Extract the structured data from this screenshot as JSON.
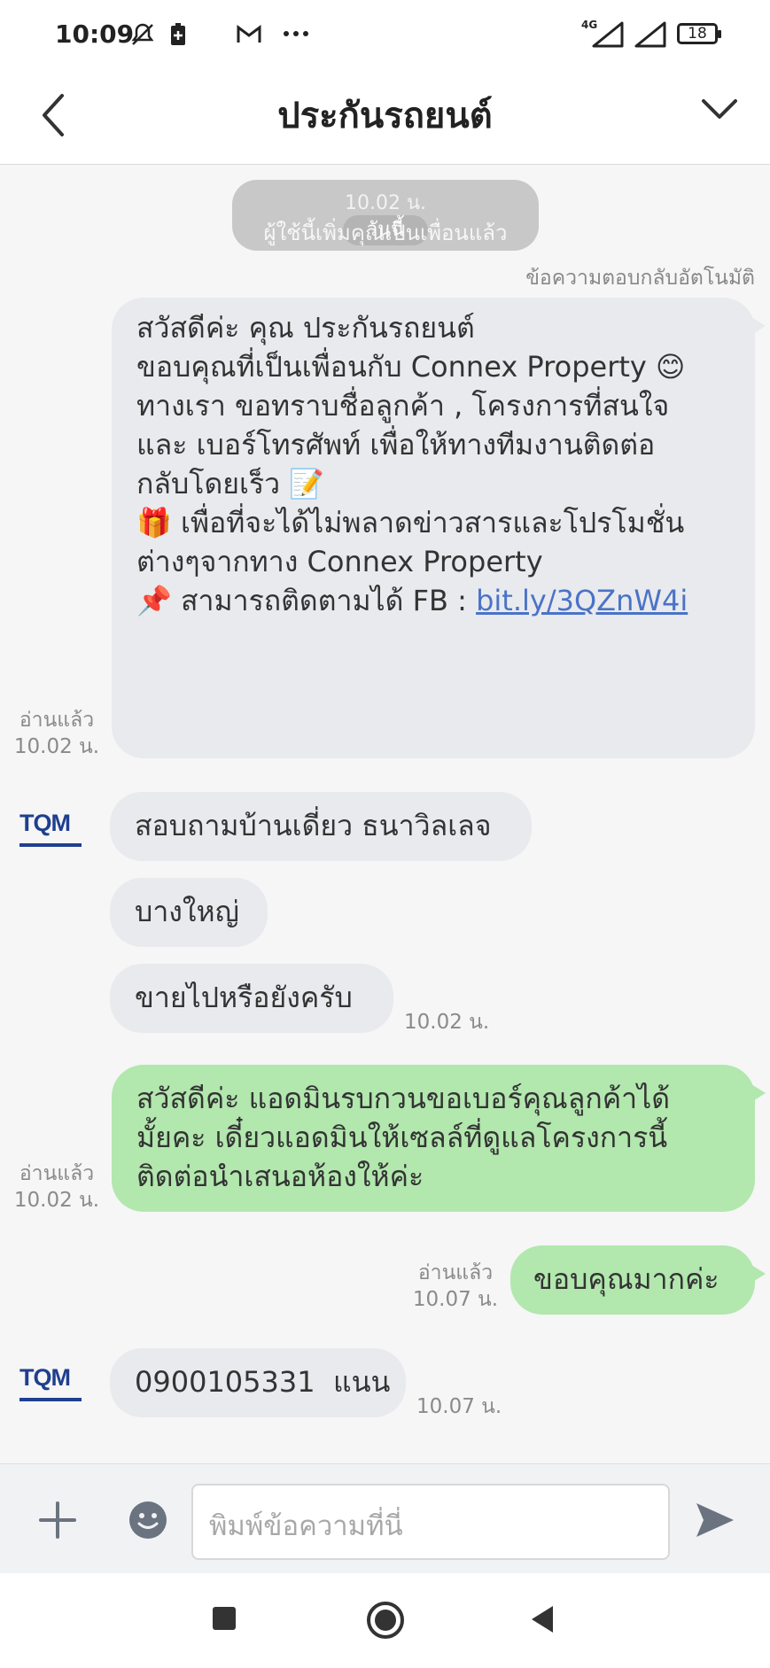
{
  "status_bar": {
    "time": "10:09",
    "network": "4G",
    "battery": "18"
  },
  "header": {
    "title": "ประกันรถยนต์"
  },
  "system_notice": {
    "time": "10.02 น.",
    "day": "วันนี้",
    "text": "ผู้ใช้นี้เพิ่มคุณเป็นเพื่อนแล้ว"
  },
  "auto_reply_label": "ข้อความตอบกลับอัตโนมัติ",
  "messages": [
    {
      "lines": [
        "สวัสดีค่ะ คุณ ประกันรถยนต์",
        "",
        "ขอบคุณที่เป็นเพื่อนกับ Connex Property 😊",
        "",
        "ทางเรา ขอทราบชื่อลูกค้า , โครงการที่สนใจ",
        "และ เบอร์โทรศัพท์ เพื่อให้ทางทีมงานติดต่อ",
        "กลับโดยเร็ว 📝",
        "",
        "🎁 เพื่อที่จะได้ไม่พลาดข่าวสารและโปรโมชั่น",
        "ต่างๆจากทาง Connex Property"
      ],
      "last_line_prefix": "📌 สามารถติดตามได้ FB : ",
      "link": "bit.ly/3QZnW4i",
      "read": "อ่านแล้ว",
      "time": "10.02 น."
    },
    {
      "text": "สอบถามบ้านเดี่ยว ธนาวิลเลจ"
    },
    {
      "text": "บางใหญ่"
    },
    {
      "text": "ขายไปหรือยังครับ",
      "time": "10.02 น."
    },
    {
      "lines": [
        "สวัสดีค่ะ แอดมินรบกวนขอเบอร์คุณลูกค้าได้",
        "มั้ยคะ เดี๋ยวแอดมินให้เซลล์ที่ดูแลโครงการนี้",
        "ติดต่อนำเสนอห้องให้ค่ะ"
      ],
      "read": "อ่านแล้ว",
      "time": "10.02 น."
    },
    {
      "text": "ขอบคุณมากค่ะ",
      "read": "อ่านแล้ว",
      "time": "10.07 น."
    },
    {
      "text": "0900105331  แนน",
      "time": "10.07 น."
    }
  ],
  "avatar_label": "TQM",
  "input": {
    "placeholder": "พิมพ์ข้อความที่นี่"
  },
  "colors": {
    "incoming_bubble": "#e9eaed",
    "outgoing_bubble": "#b2e7ae",
    "link": "#4a73c8",
    "send_icon": "#6b7280"
  }
}
